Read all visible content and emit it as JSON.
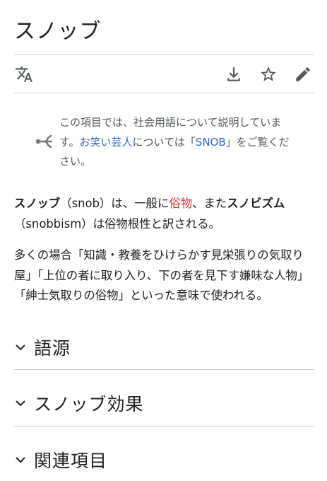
{
  "page": {
    "title": "スノッブ"
  },
  "toolbar": {
    "icons": [
      "translate-icon",
      "download-icon",
      "star-icon",
      "pencil-icon"
    ]
  },
  "hatnote": {
    "prefix": "この項目では、社会用語について説明しています。",
    "link1": "お笑い芸人",
    "middle": "については「",
    "link2": "SNOB",
    "suffix": "」をご覧ください。"
  },
  "intro": {
    "p1_a": "スノッブ",
    "p1_b": "（snob）は、一般に",
    "p1_link": "俗物",
    "p1_c": "、また",
    "p1_d": "スノビズム",
    "p1_e": "（snobbism）は俗物根性と訳される。",
    "p2": "多くの場合「知識・教養をひけらかす見栄張りの気取り屋」「上位の者に取り入り、下の者を見下す嫌味な人物」「紳士気取りの俗物」といった意味で使われる。"
  },
  "sections": [
    {
      "label": "語源"
    },
    {
      "label": "スノッブ効果"
    },
    {
      "label": "関連項目"
    }
  ],
  "colors": {
    "link": "#3366cc",
    "redlink": "#d33",
    "text": "#202122",
    "muted": "#54595d",
    "rule": "#c8ccd1"
  }
}
